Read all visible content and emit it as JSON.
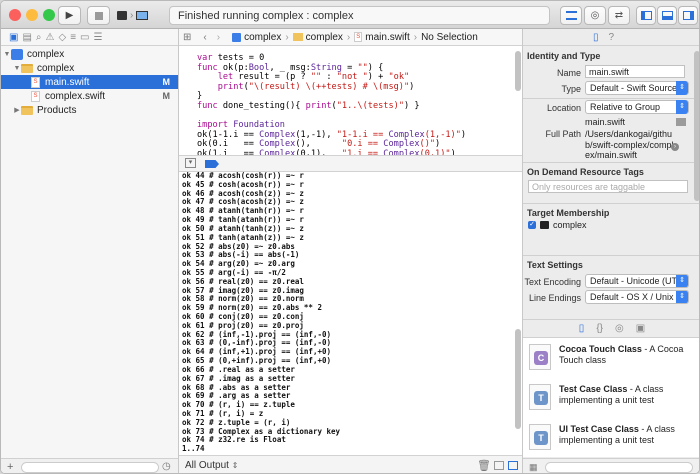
{
  "toolbar": {
    "scheme": "complex",
    "destination": "My Mac",
    "status": "Finished running complex : complex",
    "traffic": {
      "close": "#fc605c",
      "min": "#fdbc40",
      "max": "#34c84a"
    }
  },
  "navigator": {
    "items": [
      {
        "label": "complex",
        "badge": "",
        "kind": "project"
      },
      {
        "label": "complex",
        "badge": "",
        "kind": "folder"
      },
      {
        "label": "main.swift",
        "badge": "M",
        "kind": "swift"
      },
      {
        "label": "complex.swift",
        "badge": "M",
        "kind": "swift"
      },
      {
        "label": "Products",
        "badge": "",
        "kind": "folder"
      }
    ]
  },
  "jumpbar": {
    "crumbs": [
      "complex",
      "complex",
      "main.swift",
      "No Selection"
    ]
  },
  "code": [
    "var tests = 0",
    "func ok(p:Bool, _ msg:String = \"\") {",
    "    let result = (p ? \"\" : \"not \") + \"ok\"",
    "    print(\"\\(result) \\(++tests) # \\(msg)\")",
    "}",
    "func done_testing(){ print(\"1..\\(tests)\") }",
    "",
    "import Foundation",
    "ok(1-1.i == Complex(1,-1), \"1-1.i == Complex(1,-1)\")",
    "ok(0.i   == Complex(),      \"0.i == Complex()\")",
    "ok(1.i   == Complex(0,1),   \"1.i == Complex(0,1)\")"
  ],
  "console": [
    "ok 44 # acosh(cosh(r)) =~ r",
    "ok 45 # cosh(acosh(r)) =~ r",
    "ok 46 # acosh(cosh(z)) =~ z",
    "ok 47 # cosh(acosh(z)) =~ z",
    "ok 48 # atanh(tanh(r)) =~ r",
    "ok 49 # tanh(atanh(r)) =~ r",
    "ok 50 # atanh(tanh(z)) =~ z",
    "ok 51 # tanh(atanh(z)) =~ z",
    "ok 52 # abs(z0) =~ z0.abs",
    "ok 53 # abs(-i) == abs(-1)",
    "ok 54 # arg(z0) =~ z0.arg",
    "ok 55 # arg(-i) == -π/2",
    "ok 56 # real(z0) == z0.real",
    "ok 57 # imag(z0) == z0.imag",
    "ok 58 # norm(z0) == z0.norm",
    "ok 59 # norm(z0) == z0.abs ** 2",
    "ok 60 # conj(z0) == z0.conj",
    "ok 61 # proj(z0) == z0.proj",
    "ok 62 # (inf,-1).proj == (inf,-0)",
    "ok 63 # (0,-inf).proj == (inf,-0)",
    "ok 64 # (inf,+1).proj == (inf,+0)",
    "ok 65 # (0,+inf).proj == (inf,+0)",
    "ok 66 # .real as a setter",
    "ok 67 # .imag as a setter",
    "ok 68 # .abs as a setter",
    "ok 69 # .arg as a setter",
    "ok 70 # (r, i) == z.tuple",
    "ok 71 # (r, i) = z",
    "ok 72 # z.tuple = (r, i)",
    "ok 73 # Complex as a dictionary key",
    "ok 74 # z32.re is Float",
    "1..74",
    "Program ended with exit code: 0"
  ],
  "console_footer": {
    "filter": "All Output"
  },
  "inspector": {
    "identity_title": "Identity and Type",
    "name_label": "Name",
    "name_value": "main.swift",
    "type_label": "Type",
    "type_value": "Default - Swift Source",
    "location_label": "Location",
    "location_value": "Relative to Group",
    "location_file": "main.swift",
    "fullpath_label": "Full Path",
    "fullpath_value": "/Users/dankogai/github/swift-complex/complex/main.swift",
    "ondemand_title": "On Demand Resource Tags",
    "ondemand_placeholder": "Only resources are taggable",
    "target_title": "Target Membership",
    "target_name": "complex",
    "text_title": "Text Settings",
    "encoding_label": "Text Encoding",
    "encoding_value": "Default - Unicode (UTF-8)",
    "endings_label": "Line Endings",
    "endings_value": "Default - OS X / Unix (LF)"
  },
  "library": [
    {
      "title": "Cocoa Touch Class",
      "desc": " - A Cocoa Touch class",
      "mark": "C",
      "color": "#9b7fc7"
    },
    {
      "title": "Test Case Class",
      "desc": " - A class implementing a unit test",
      "mark": "T",
      "color": "#6e95c9"
    },
    {
      "title": "UI Test Case Class",
      "desc": " - A class implementing a unit test",
      "mark": "T",
      "color": "#6e95c9"
    }
  ]
}
